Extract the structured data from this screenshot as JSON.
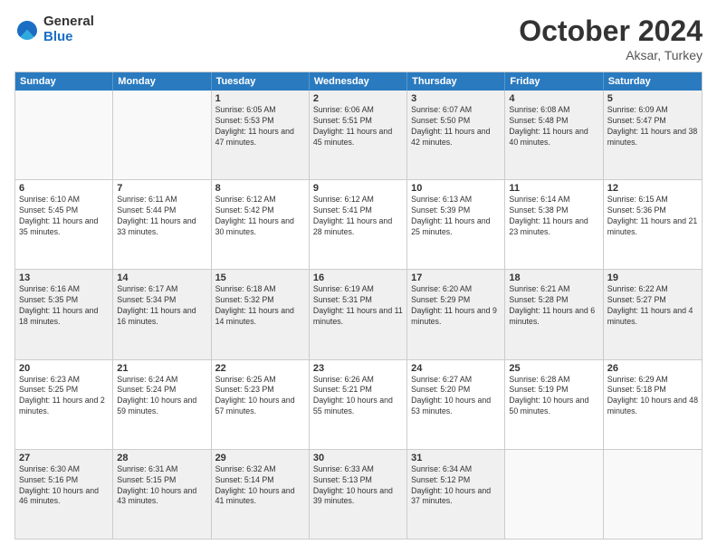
{
  "logo": {
    "general": "General",
    "blue": "Blue"
  },
  "header": {
    "month": "October 2024",
    "location": "Aksar, Turkey"
  },
  "weekdays": [
    "Sunday",
    "Monday",
    "Tuesday",
    "Wednesday",
    "Thursday",
    "Friday",
    "Saturday"
  ],
  "rows": [
    [
      {
        "day": "",
        "empty": true
      },
      {
        "day": "",
        "empty": true
      },
      {
        "day": "1",
        "sunrise": "6:05 AM",
        "sunset": "5:53 PM",
        "daylight": "11 hours and 47 minutes."
      },
      {
        "day": "2",
        "sunrise": "6:06 AM",
        "sunset": "5:51 PM",
        "daylight": "11 hours and 45 minutes."
      },
      {
        "day": "3",
        "sunrise": "6:07 AM",
        "sunset": "5:50 PM",
        "daylight": "11 hours and 42 minutes."
      },
      {
        "day": "4",
        "sunrise": "6:08 AM",
        "sunset": "5:48 PM",
        "daylight": "11 hours and 40 minutes."
      },
      {
        "day": "5",
        "sunrise": "6:09 AM",
        "sunset": "5:47 PM",
        "daylight": "11 hours and 38 minutes."
      }
    ],
    [
      {
        "day": "6",
        "sunrise": "6:10 AM",
        "sunset": "5:45 PM",
        "daylight": "11 hours and 35 minutes."
      },
      {
        "day": "7",
        "sunrise": "6:11 AM",
        "sunset": "5:44 PM",
        "daylight": "11 hours and 33 minutes."
      },
      {
        "day": "8",
        "sunrise": "6:12 AM",
        "sunset": "5:42 PM",
        "daylight": "11 hours and 30 minutes."
      },
      {
        "day": "9",
        "sunrise": "6:12 AM",
        "sunset": "5:41 PM",
        "daylight": "11 hours and 28 minutes."
      },
      {
        "day": "10",
        "sunrise": "6:13 AM",
        "sunset": "5:39 PM",
        "daylight": "11 hours and 25 minutes."
      },
      {
        "day": "11",
        "sunrise": "6:14 AM",
        "sunset": "5:38 PM",
        "daylight": "11 hours and 23 minutes."
      },
      {
        "day": "12",
        "sunrise": "6:15 AM",
        "sunset": "5:36 PM",
        "daylight": "11 hours and 21 minutes."
      }
    ],
    [
      {
        "day": "13",
        "sunrise": "6:16 AM",
        "sunset": "5:35 PM",
        "daylight": "11 hours and 18 minutes."
      },
      {
        "day": "14",
        "sunrise": "6:17 AM",
        "sunset": "5:34 PM",
        "daylight": "11 hours and 16 minutes."
      },
      {
        "day": "15",
        "sunrise": "6:18 AM",
        "sunset": "5:32 PM",
        "daylight": "11 hours and 14 minutes."
      },
      {
        "day": "16",
        "sunrise": "6:19 AM",
        "sunset": "5:31 PM",
        "daylight": "11 hours and 11 minutes."
      },
      {
        "day": "17",
        "sunrise": "6:20 AM",
        "sunset": "5:29 PM",
        "daylight": "11 hours and 9 minutes."
      },
      {
        "day": "18",
        "sunrise": "6:21 AM",
        "sunset": "5:28 PM",
        "daylight": "11 hours and 6 minutes."
      },
      {
        "day": "19",
        "sunrise": "6:22 AM",
        "sunset": "5:27 PM",
        "daylight": "11 hours and 4 minutes."
      }
    ],
    [
      {
        "day": "20",
        "sunrise": "6:23 AM",
        "sunset": "5:25 PM",
        "daylight": "11 hours and 2 minutes."
      },
      {
        "day": "21",
        "sunrise": "6:24 AM",
        "sunset": "5:24 PM",
        "daylight": "10 hours and 59 minutes."
      },
      {
        "day": "22",
        "sunrise": "6:25 AM",
        "sunset": "5:23 PM",
        "daylight": "10 hours and 57 minutes."
      },
      {
        "day": "23",
        "sunrise": "6:26 AM",
        "sunset": "5:21 PM",
        "daylight": "10 hours and 55 minutes."
      },
      {
        "day": "24",
        "sunrise": "6:27 AM",
        "sunset": "5:20 PM",
        "daylight": "10 hours and 53 minutes."
      },
      {
        "day": "25",
        "sunrise": "6:28 AM",
        "sunset": "5:19 PM",
        "daylight": "10 hours and 50 minutes."
      },
      {
        "day": "26",
        "sunrise": "6:29 AM",
        "sunset": "5:18 PM",
        "daylight": "10 hours and 48 minutes."
      }
    ],
    [
      {
        "day": "27",
        "sunrise": "6:30 AM",
        "sunset": "5:16 PM",
        "daylight": "10 hours and 46 minutes."
      },
      {
        "day": "28",
        "sunrise": "6:31 AM",
        "sunset": "5:15 PM",
        "daylight": "10 hours and 43 minutes."
      },
      {
        "day": "29",
        "sunrise": "6:32 AM",
        "sunset": "5:14 PM",
        "daylight": "10 hours and 41 minutes."
      },
      {
        "day": "30",
        "sunrise": "6:33 AM",
        "sunset": "5:13 PM",
        "daylight": "10 hours and 39 minutes."
      },
      {
        "day": "31",
        "sunrise": "6:34 AM",
        "sunset": "5:12 PM",
        "daylight": "10 hours and 37 minutes."
      },
      {
        "day": "",
        "empty": true
      },
      {
        "day": "",
        "empty": true
      }
    ]
  ],
  "labels": {
    "sunrise": "Sunrise:",
    "sunset": "Sunset:",
    "daylight": "Daylight:"
  }
}
